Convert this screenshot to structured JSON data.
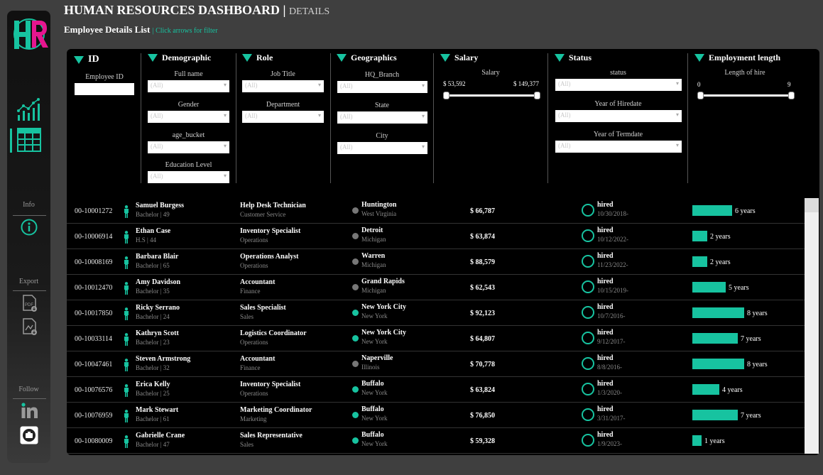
{
  "header": {
    "title": "HUMAN RESOURCES DASHBOARD |",
    "title_sub": "DETAILS",
    "subtitle": "Employee Details List",
    "subtitle_hint": "| Click arrows for filter"
  },
  "sidebar": {
    "logo_text": "HR",
    "nav": [
      {
        "icon": "line-chart-icon",
        "active": false
      },
      {
        "icon": "table-icon",
        "active": true
      }
    ],
    "sections": {
      "info_label": "Info",
      "export_label": "Export",
      "follow_label": "Follow"
    },
    "accent_color": "#17c3a0",
    "brand_colors": [
      "#e6168f",
      "#17c3a0"
    ]
  },
  "filters": {
    "id": {
      "title": "ID",
      "label": "Employee ID",
      "value": ""
    },
    "demographic": {
      "title": "Demographic",
      "fields": [
        {
          "label": "Full name",
          "value": "(All)"
        },
        {
          "label": "Gender",
          "value": "(All)"
        },
        {
          "label": "age_bucket",
          "value": "(All)"
        },
        {
          "label": "Education Level",
          "value": "(All)"
        }
      ]
    },
    "role": {
      "title": "Role",
      "fields": [
        {
          "label": "Job Title",
          "value": "(All)"
        },
        {
          "label": "Department",
          "value": "(All)"
        }
      ]
    },
    "geographics": {
      "title": "Geographics",
      "fields": [
        {
          "label": "HQ_Branch",
          "value": "(All)"
        },
        {
          "label": "State",
          "value": "(All)"
        },
        {
          "label": "City",
          "value": "(All)"
        }
      ]
    },
    "salary": {
      "title": "Salary",
      "label": "Salary",
      "min": "$ 53,592",
      "max": "$ 149,377"
    },
    "status": {
      "title": "Status",
      "fields": [
        {
          "label": "status",
          "value": "(All)"
        },
        {
          "label": "Year of Hiredate",
          "value": "(All)"
        },
        {
          "label": "Year of Termdate",
          "value": "(All)"
        }
      ]
    },
    "employment_length": {
      "title": "Employment length",
      "label": "Length of hire",
      "min": "0",
      "max": "9"
    }
  },
  "employees": [
    {
      "id": "00-10001272",
      "name": "Samuel Burgess",
      "meta": "Bachelor | 49",
      "job": "Help Desk Technician",
      "dept": "Customer Service",
      "city": "Huntington",
      "state": "West Virginia",
      "hq": false,
      "salary": "$ 66,787",
      "status": "hired",
      "hiredate": "10/30/2018-",
      "years": 6,
      "years_label": "6 years"
    },
    {
      "id": "00-10006914",
      "name": "Ethan Case",
      "meta": "H.S | 44",
      "job": "Inventory Specialist",
      "dept": "Operations",
      "city": "Detroit",
      "state": "Michigan",
      "hq": false,
      "salary": "$ 63,874",
      "status": "hired",
      "hiredate": "10/12/2022-",
      "years": 2,
      "years_label": "2 years"
    },
    {
      "id": "00-10008169",
      "name": "Barbara Blair",
      "meta": "Bachelor | 65",
      "job": "Operations Analyst",
      "dept": "Operations",
      "city": "Warren",
      "state": "Michigan",
      "hq": false,
      "salary": "$ 88,579",
      "status": "hired",
      "hiredate": "11/23/2022-",
      "years": 2,
      "years_label": "2 years"
    },
    {
      "id": "00-10012470",
      "name": "Amy Davidson",
      "meta": "Bachelor | 35",
      "job": "Accountant",
      "dept": "Finance",
      "city": "Grand Rapids",
      "state": "Michigan",
      "hq": false,
      "salary": "$ 62,543",
      "status": "hired",
      "hiredate": "10/15/2019-",
      "years": 5,
      "years_label": "5 years"
    },
    {
      "id": "00-10017850",
      "name": "Ricky Serrano",
      "meta": "Bachelor | 24",
      "job": "Sales Specialist",
      "dept": "Sales",
      "city": "New York City",
      "state": "New York",
      "hq": true,
      "salary": "$ 92,123",
      "status": "hired",
      "hiredate": "10/7/2016-",
      "years": 8,
      "years_label": "8 years"
    },
    {
      "id": "00-10033114",
      "name": "Kathryn Scott",
      "meta": "Bachelor | 23",
      "job": "Logistics Coordinator",
      "dept": "Operations",
      "city": "New York City",
      "state": "New York",
      "hq": true,
      "salary": "$ 64,807",
      "status": "hired",
      "hiredate": "9/12/2017-",
      "years": 7,
      "years_label": "7 years"
    },
    {
      "id": "00-10047461",
      "name": "Steven Armstrong",
      "meta": "Bachelor | 32",
      "job": "Accountant",
      "dept": "Finance",
      "city": "Naperville",
      "state": "Illinois",
      "hq": false,
      "salary": "$ 70,778",
      "status": "hired",
      "hiredate": "8/8/2016-",
      "years": 8,
      "years_label": "8 years"
    },
    {
      "id": "00-10076576",
      "name": "Erica Kelly",
      "meta": "Bachelor | 25",
      "job": "Inventory Specialist",
      "dept": "Operations",
      "city": "Buffalo",
      "state": "New York",
      "hq": true,
      "salary": "$ 63,824",
      "status": "hired",
      "hiredate": "1/3/2020-",
      "years": 4,
      "years_label": "4 years"
    },
    {
      "id": "00-10076959",
      "name": "Mark Stewart",
      "meta": "Bachelor | 61",
      "job": "Marketing Coordinator",
      "dept": "Marketing",
      "city": "Buffalo",
      "state": "New York",
      "hq": true,
      "salary": "$ 76,850",
      "status": "hired",
      "hiredate": "3/31/2017-",
      "years": 7,
      "years_label": "7 years"
    },
    {
      "id": "00-10080009",
      "name": "Gabrielle Crane",
      "meta": "Bachelor | 47",
      "job": "Sales Representative",
      "dept": "Sales",
      "city": "Buffalo",
      "state": "New York",
      "hq": true,
      "salary": "$ 59,328",
      "status": "hired",
      "hiredate": "1/9/2023-",
      "years": 1,
      "years_label": "1 years"
    }
  ],
  "colors": {
    "accent": "#17c3a0",
    "hq_dot": "#17c3a0",
    "non_hq_dot": "#777777"
  }
}
